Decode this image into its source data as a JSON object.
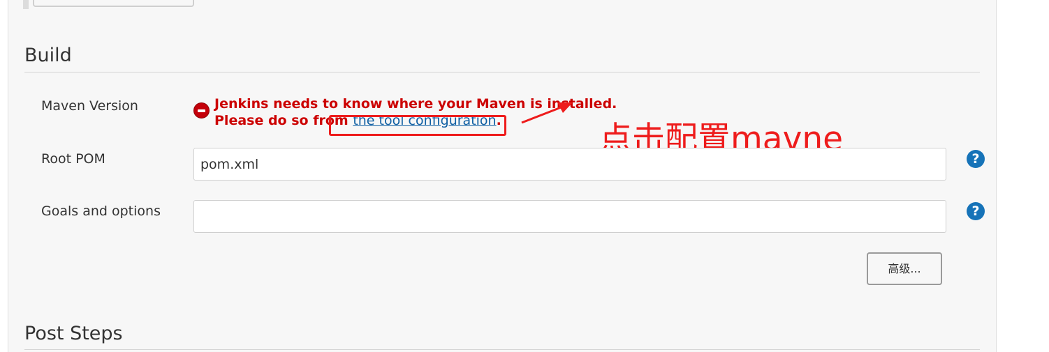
{
  "sections": {
    "build_title": "Build",
    "post_steps_title": "Post Steps"
  },
  "maven_version": {
    "label": "Maven Version",
    "error_line1": "Jenkins needs to know where your Maven is installed.",
    "error_line2_prefix": "Please do so from ",
    "error_link": "the tool configuration",
    "error_line2_suffix": "."
  },
  "root_pom": {
    "label": "Root POM",
    "value": "pom.xml",
    "help": "?"
  },
  "goals": {
    "label": "Goals and options",
    "value": "",
    "help": "?"
  },
  "advanced_button": "高级...",
  "annotation": {
    "text": "点击配置mavne",
    "color": "#ee1c1c"
  },
  "colors": {
    "error": "#cc0000",
    "link": "#0f5fa3",
    "help": "#1673b8"
  }
}
